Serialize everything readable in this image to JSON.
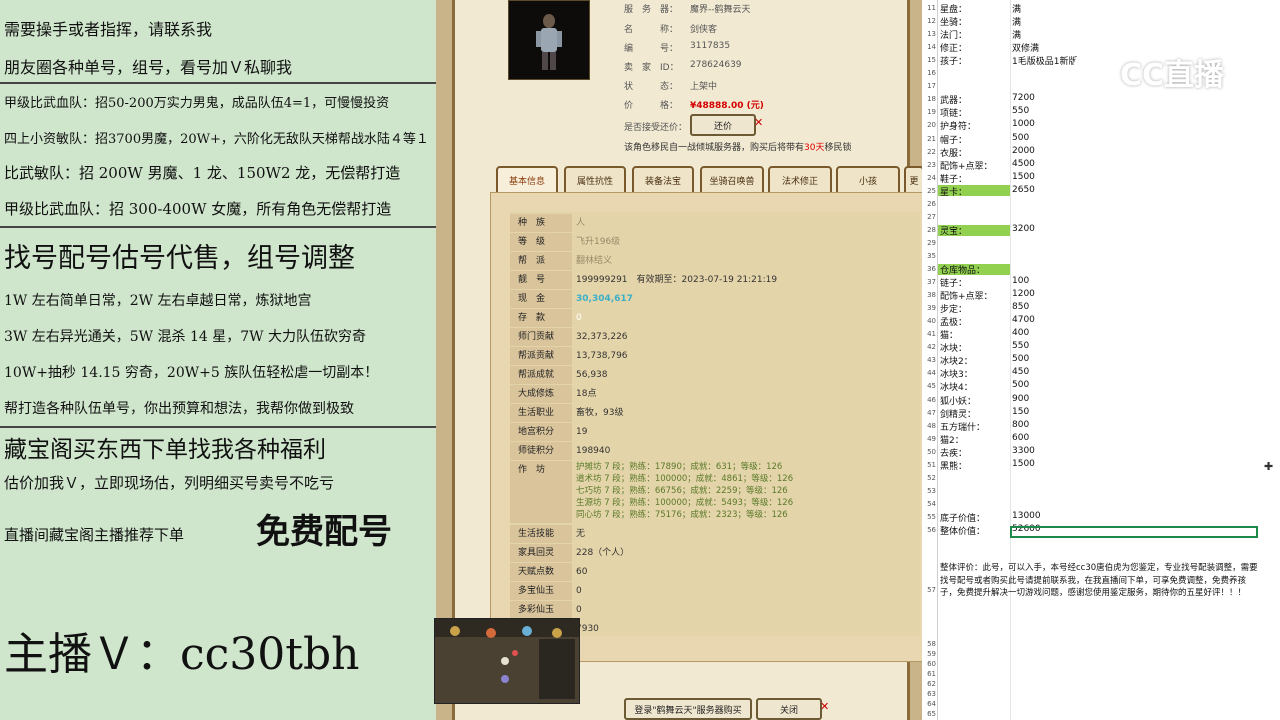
{
  "left_panel": {
    "lines": [
      "需要操手或者指挥，请联系我",
      "朋友圈各种单号，组号，看号加Ｖ私聊我",
      "甲级比武血队：招50-200万实力男鬼，成品队伍4=1，可慢慢投资",
      "四上小资敏队：招3700男魔，20W+，六阶化无敌队天梯帮战水陆４等１",
      "比武敏队：招 200W 男魔、1 龙、150W2 龙，无偿帮打造",
      "甲级比武血队：招 300-400W 女魔，所有角色无偿帮打造",
      "找号配号估号代售，组号调整",
      "1W 左右简单日常，2W 左右卓越日常，炼狱地宫",
      "3W 左右异光通关，5W 混杀 14 星，7W 大力队伍砍穷奇",
      "10W+抽秒 14.15 穷奇，20W+5 族队伍轻松虐一切副本！",
      "帮打造各种队伍单号，你出预算和想法，我帮你做到极致",
      "藏宝阁买东西下单找我各种福利",
      "估价加我Ｖ，立即现场估，列明细买号卖号不吃亏",
      "直播间藏宝阁主播推荐下单",
      "免费配号",
      "主播Ｖ：cc30tbh"
    ]
  },
  "game": {
    "server_label": "服　务　器：",
    "server_value": "魔界--鹤舞云天",
    "name_label": "名　　　称：",
    "name_value": "剑侠客",
    "id_label": "编　　　号：",
    "id_value": "3117835",
    "seller_label": "卖　家　ID：",
    "seller_value": "278624639",
    "status_label": "状　　　态：",
    "status_value": "上架中",
    "price_label": "价　　　格：",
    "price_value": "¥48888.00 (元)",
    "bargain_label": "是否接受还价：",
    "bargain_button": "还价",
    "notice_pre": "该角色移民自一战倾城服务器，购买后将带有",
    "notice_days": "30天",
    "notice_post": "移民锁",
    "tabs": [
      "基本信息",
      "属性抗性",
      "装备法宝",
      "坐骑召唤兽",
      "法术修正",
      "小孩",
      "更"
    ],
    "info_rows": [
      {
        "k": "种　族",
        "v": "人"
      },
      {
        "k": "等　级",
        "v": "飞升196级"
      },
      {
        "k": "帮　派",
        "v": "翻林结义"
      },
      {
        "k": "靓　号",
        "v": "199999291　有效期至：2023-07-19 21:21:19"
      },
      {
        "k": "现　金",
        "v": "30,304,617"
      },
      {
        "k": "存　款",
        "v": "0"
      },
      {
        "k": "师门贡献",
        "v": "32,373,226"
      },
      {
        "k": "帮派贡献",
        "v": "13,738,796"
      },
      {
        "k": "帮派成就",
        "v": "56,938"
      },
      {
        "k": "大成修炼",
        "v": "18点"
      },
      {
        "k": "生活职业",
        "v": "畜牧，93级"
      },
      {
        "k": "地宫积分",
        "v": "19"
      },
      {
        "k": "师徒积分",
        "v": "198940"
      }
    ],
    "workshop_label": "作　坊",
    "workshop": [
      "护摊坊 7 段；熟练：17890；成就：631；等级：126",
      "道术坊 7 段；熟练：100000；成就：4861；等级：126",
      "七巧坊 7 段；熟练：66756；成就：2259；等级：126",
      "生源坊 7 段；熟练：100000；成就：5493；等级：126",
      "同心坊 7 段；熟练：75176；成就：2323；等级：126"
    ],
    "info_rows2": [
      {
        "k": "生活技能",
        "v": "无"
      },
      {
        "k": "家具回灵",
        "v": "228（个人）"
      },
      {
        "k": "天赋点数",
        "v": "60"
      },
      {
        "k": "多宝仙玉",
        "v": "0"
      },
      {
        "k": "多彩仙玉",
        "v": "0"
      },
      {
        "k": "",
        "v": "7930"
      }
    ],
    "login_button": "登录\"鹤舞云天\"服务器购买",
    "close_button": "关闭"
  },
  "sheet": {
    "rows": [
      {
        "n": "11",
        "a": "星盘：",
        "b": "满"
      },
      {
        "n": "12",
        "a": "坐骑：",
        "b": "满"
      },
      {
        "n": "13",
        "a": "法门：",
        "b": "满"
      },
      {
        "n": "14",
        "a": "修正：",
        "b": "双修满"
      },
      {
        "n": "15",
        "a": "孩子：",
        "b": "1毛版极品1新版"
      },
      {
        "n": "16",
        "a": "",
        "b": ""
      },
      {
        "n": "17",
        "a": "",
        "b": ""
      },
      {
        "n": "18",
        "a": "武器：",
        "b": "7200"
      },
      {
        "n": "19",
        "a": "项链：",
        "b": "550"
      },
      {
        "n": "20",
        "a": "护身符：",
        "b": "1000"
      },
      {
        "n": "21",
        "a": "帽子：",
        "b": "500"
      },
      {
        "n": "22",
        "a": "衣服：",
        "b": "2000"
      },
      {
        "n": "23",
        "a": "配饰+点翠：",
        "b": "4500"
      },
      {
        "n": "24",
        "a": "鞋子：",
        "b": "1500"
      },
      {
        "n": "25",
        "a": "星卡：",
        "b": "2650"
      },
      {
        "n": "26",
        "a": "",
        "b": ""
      },
      {
        "n": "27",
        "a": "",
        "b": ""
      },
      {
        "n": "28",
        "a": "灵宝：",
        "b": "3200"
      },
      {
        "n": "29",
        "a": "",
        "b": ""
      },
      {
        "n": "35",
        "a": "",
        "b": ""
      },
      {
        "n": "36",
        "a": "仓库物品：",
        "b": ""
      },
      {
        "n": "37",
        "a": "链子：",
        "b": "100"
      },
      {
        "n": "38",
        "a": "配饰+点翠：",
        "b": "1200"
      },
      {
        "n": "39",
        "a": "步定：",
        "b": "850"
      },
      {
        "n": "40",
        "a": "孟极：",
        "b": "4700"
      },
      {
        "n": "41",
        "a": "猫：",
        "b": "400"
      },
      {
        "n": "42",
        "a": "冰块：",
        "b": "550"
      },
      {
        "n": "43",
        "a": "冰块2：",
        "b": "500"
      },
      {
        "n": "44",
        "a": "冰块3：",
        "b": "450"
      },
      {
        "n": "45",
        "a": "冰块4：",
        "b": "500"
      },
      {
        "n": "46",
        "a": "狐小妖：",
        "b": "900"
      },
      {
        "n": "47",
        "a": "剑精灵：",
        "b": "150"
      },
      {
        "n": "48",
        "a": "五方瑞什：",
        "b": "800"
      },
      {
        "n": "49",
        "a": "猫2：",
        "b": "600"
      },
      {
        "n": "50",
        "a": "去疾：",
        "b": "3300"
      },
      {
        "n": "51",
        "a": "黑熊：",
        "b": "1500"
      },
      {
        "n": "52",
        "a": "",
        "b": ""
      },
      {
        "n": "53",
        "a": "",
        "b": ""
      },
      {
        "n": "54",
        "a": "",
        "b": ""
      },
      {
        "n": "55",
        "a": "底子价值：",
        "b": "13000"
      },
      {
        "n": "56",
        "a": "整体价值：",
        "b": "52600"
      }
    ],
    "comment_rownum": "57",
    "comment": "整体评价：此号，可以入手，本号经cc30唐伯虎为您鉴定，专业找号配装调整，需要找号配号或者购买此号请提前联系我，在我直播间下单，可享免费调整，免费养孩子，免费提升解决一切游戏问题，感谢您使用鉴定服务，期待你的五星好评！！！",
    "tail_rows": [
      "58",
      "59",
      "60",
      "61",
      "62",
      "63",
      "64",
      "65"
    ]
  },
  "watermark": "CC直播"
}
